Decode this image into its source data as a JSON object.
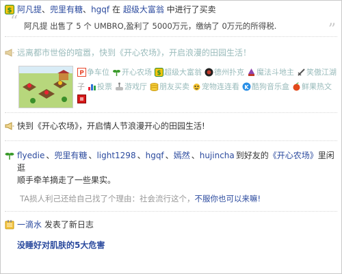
{
  "feed": {
    "item1": {
      "actors": [
        "阿凡提",
        "兜里有糖",
        "hgqf"
      ],
      "mid_text": "在",
      "app_link": "超级大富翁",
      "end_text": "中进行了买卖",
      "quote": "阿凡提 出售了 5 个 UMBRO,盈利了 5000万元，缴纳了 0万元的所得税."
    },
    "item2": {
      "headline": "远离都市世俗的喧嚣，快到《开心农场》，开启浪漫的田园生活！",
      "apps": [
        {
          "label": "争车位",
          "icon": "parking-icon",
          "color": "#e8462b"
        },
        {
          "label": "开心农场",
          "icon": "sprout-icon",
          "color": "#3a9a2a"
        },
        {
          "label": "超级大富翁",
          "icon": "money-icon",
          "color": "#2e8b2e"
        },
        {
          "label": "德州扑克",
          "icon": "poker-chip-icon",
          "color": "#c0392b"
        },
        {
          "label": "魔法斗地主",
          "icon": "wizard-icon",
          "color": "#8e44ad"
        },
        {
          "label": "笑傲江湖",
          "icon": "sword-icon",
          "color": "#555555"
        },
        {
          "label": "子",
          "icon": "",
          "color": ""
        },
        {
          "label": "投票",
          "icon": "bar-chart-icon",
          "color": "#2a6fd6"
        },
        {
          "label": "游戏厅",
          "icon": "joystick-icon",
          "color": "#7a7a7a"
        },
        {
          "label": "朋友买卖",
          "icon": "coin-icon",
          "color": "#e6b422"
        },
        {
          "label": "宠物连连看",
          "icon": "pet-icon",
          "color": "#e6b422"
        },
        {
          "label": "酷狗音乐盒",
          "icon": "music-k-icon",
          "color": "#2a8fe6"
        },
        {
          "label": "鲜果热文",
          "icon": "apple-icon",
          "color": "#e24a1c"
        },
        {
          "label": "",
          "icon": "red-square-icon",
          "color": "#d61a1a"
        }
      ]
    },
    "item3": {
      "text": "快到《开心农场》，开启情人节浪漫开心的田园生活!"
    },
    "item4": {
      "actors": [
        "flyedie",
        "兜里有糖",
        "light1298",
        "hgqf",
        "嫣然",
        "hujincha"
      ],
      "action_prefix": "到好友的",
      "app_link": "《开心农场》",
      "action_suffix": "里闲逛",
      "line2": "顺手牵羊摘走了一些果实。",
      "reason_text": "TA损人利己还给自己找了个理由：社会流行这个，",
      "reason_link": "不服你也可以来嘛!"
    },
    "item5": {
      "actor": "一滴水",
      "action": "发表了新日志",
      "blog_title": "没睡好对肌肤的5大危害"
    }
  }
}
